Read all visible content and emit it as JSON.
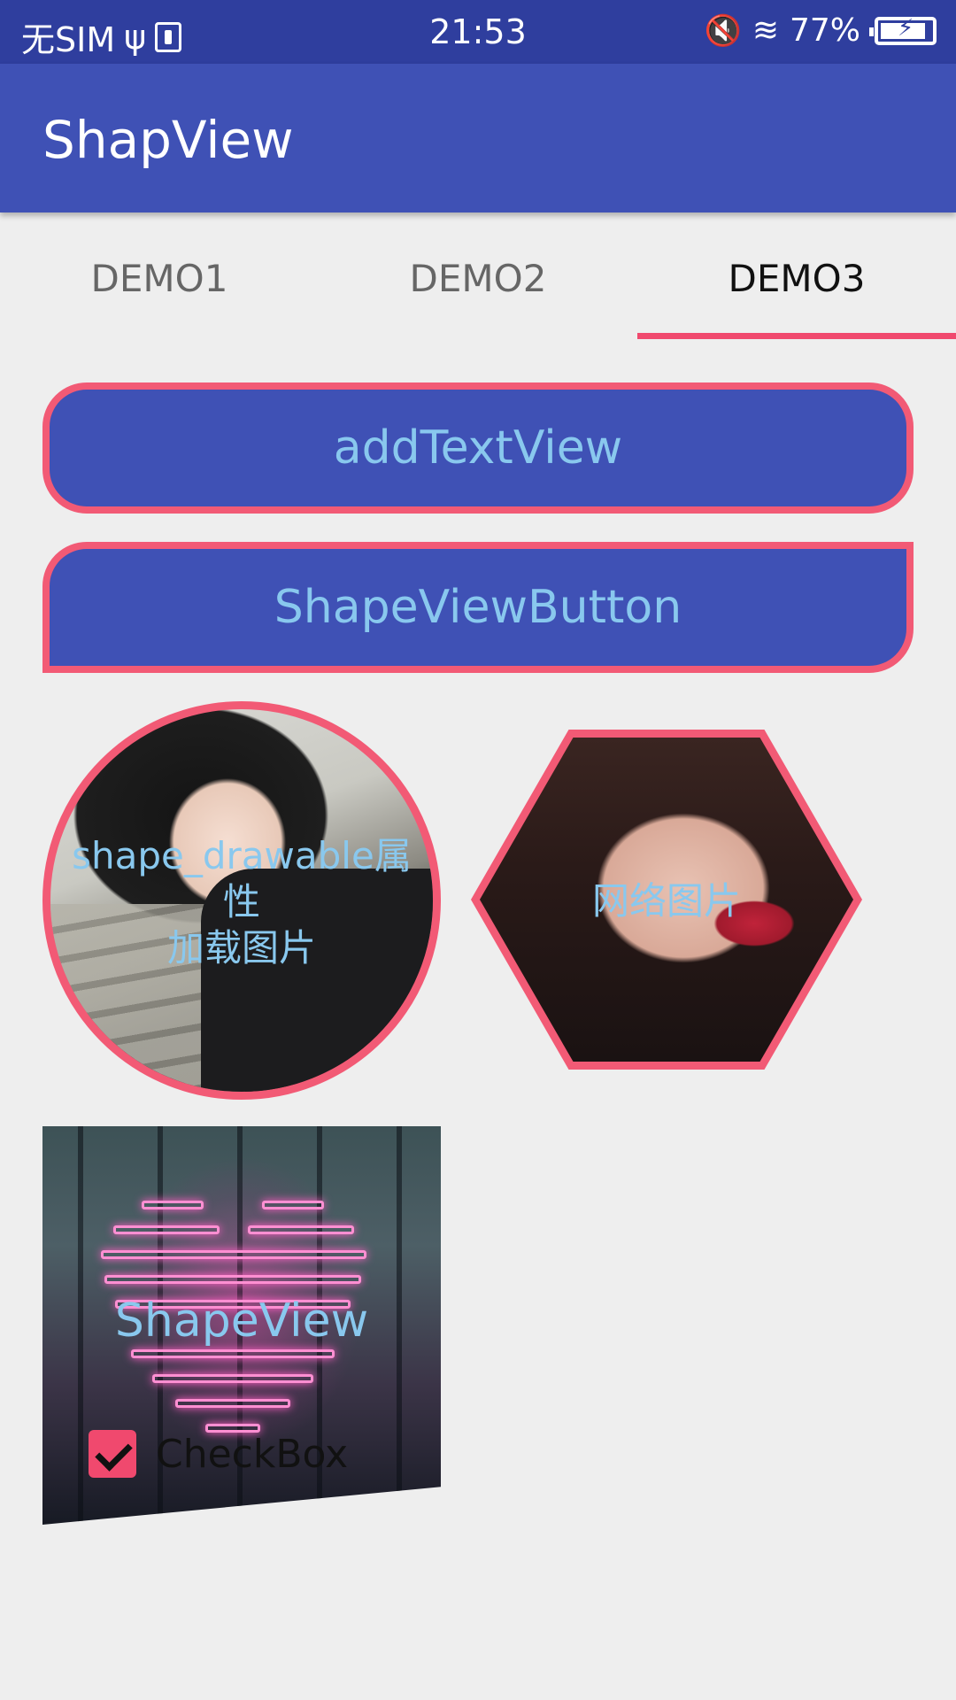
{
  "status_bar": {
    "carrier": "无SIM",
    "usb_glyph": "ψ",
    "time": "21:53",
    "mute_glyph": "🔇",
    "wifi_glyph": "≋",
    "battery_percent": "77%",
    "battery_level": 0.77
  },
  "toolbar": {
    "title": "ShapView"
  },
  "tabs": [
    {
      "label": "DEMO1",
      "active": false
    },
    {
      "label": "DEMO2",
      "active": false
    },
    {
      "label": "DEMO3",
      "active": true
    }
  ],
  "buttons": {
    "add_text_view": "addTextView",
    "shape_view_button": "ShapeViewButton"
  },
  "circle_image": {
    "line1": "shape_drawable属",
    "line2": "性",
    "line3": "加载图片"
  },
  "hexagon_image": {
    "text": "网络图片"
  },
  "trapezoid_image": {
    "text": "ShapeView",
    "checkbox_label": "CheckBox",
    "checkbox_checked": true
  },
  "colors": {
    "primary": "#3f51b5",
    "status_bar": "#2f3e9e",
    "accent": "#f0496e",
    "stroke": "#f25a75",
    "label_text": "#89c8ee"
  }
}
